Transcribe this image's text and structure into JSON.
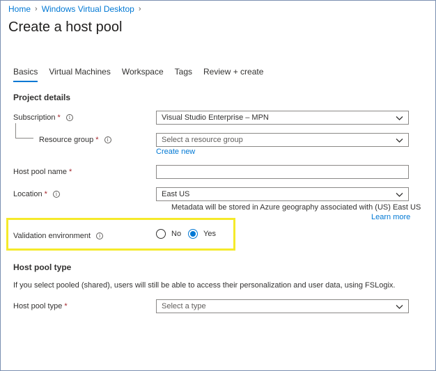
{
  "breadcrumb": {
    "home": "Home",
    "parent": "Windows Virtual Desktop"
  },
  "page_title": "Create a host pool",
  "tabs": [
    {
      "label": "Basics",
      "active": true
    },
    {
      "label": "Virtual Machines",
      "active": false
    },
    {
      "label": "Workspace",
      "active": false
    },
    {
      "label": "Tags",
      "active": false
    },
    {
      "label": "Review + create",
      "active": false
    }
  ],
  "project_details": {
    "title": "Project details",
    "subscription": {
      "label": "Subscription",
      "required": "*",
      "value": "Visual Studio Enterprise – MPN"
    },
    "resource_group": {
      "label": "Resource group",
      "required": "*",
      "placeholder": "Select a resource group",
      "create_new": "Create new"
    },
    "host_pool_name": {
      "label": "Host pool name",
      "required": "*",
      "value": ""
    },
    "location": {
      "label": "Location",
      "required": "*",
      "value": "East US",
      "metadata_note": "Metadata will be stored in Azure geography associated with (US) East US",
      "learn_more": "Learn more"
    },
    "validation_environment": {
      "label": "Validation environment",
      "options": [
        "No",
        "Yes"
      ],
      "selected": "Yes"
    }
  },
  "host_pool_type_section": {
    "title": "Host pool type",
    "description": "If you select pooled (shared), users will still be able to access their personalization and user data, using FSLogix.",
    "host_pool_type": {
      "label": "Host pool type",
      "required": "*",
      "placeholder": "Select a type"
    }
  },
  "colors": {
    "accent": "#0078d4",
    "required": "#a4262c",
    "highlight": "#f5ea2a"
  },
  "icons": {
    "info": "info-icon",
    "chevron": "chevron-down-icon",
    "breadcrumb_sep": "chevron-right-icon"
  }
}
